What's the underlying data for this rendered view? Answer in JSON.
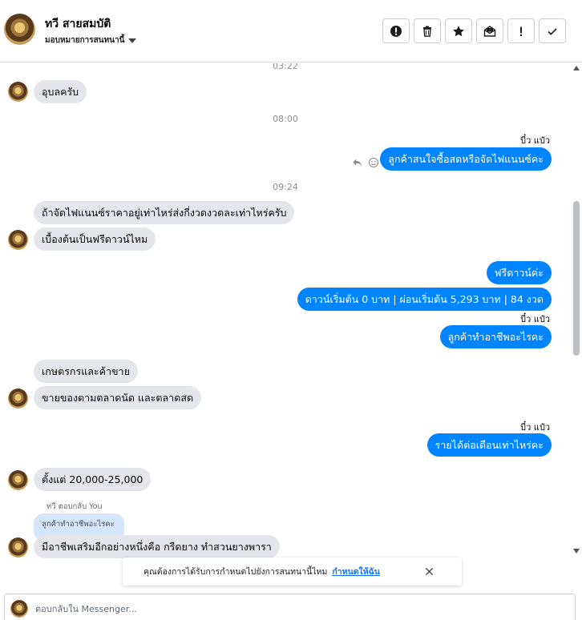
{
  "header": {
    "contact_name": "ทวี สายสมบัติ",
    "assign_label": "มอบหมายการสนทนานี้",
    "tools": [
      {
        "icon": "alert-circle-icon",
        "name": "spam-button"
      },
      {
        "icon": "trash-icon",
        "name": "delete-button"
      },
      {
        "icon": "star-icon",
        "name": "star-button"
      },
      {
        "icon": "mail-open-icon",
        "name": "mark-unread-button"
      },
      {
        "icon": "exclamation-icon",
        "name": "follow-up-button"
      },
      {
        "icon": "check-icon",
        "name": "done-button"
      }
    ]
  },
  "conversation": {
    "timestamps": [
      "03:22",
      "08:00",
      "09:24"
    ],
    "messages": {
      "m1": "อุบลครับ",
      "m2": "ลูกค้าสนใจซื้อสดหรือจัดไฟแนนซ์คะ",
      "m3": "ถ้าจัดไฟแนนซ์ราคาอยู่เท่าไหร่ส่งกี่งวดงวดละเท่าไหร่ครับ",
      "m4": "เบื้องต้นเป็นฟรีดาวน์ไหม",
      "m5": "ฟรีดาวน์ค่ะ",
      "m6": "ดาวน์เริ่มต้น 0 บาท | ผ่อนเริ่มต้น 5,293 บาท | 84 งวด",
      "m7": "ลูกค้าทำอาชีพอะไรคะ",
      "m8": "เกษตรกรและค้าขาย",
      "m9": "ขายของตามตลาดนัด และตลาดสด",
      "m10": "รายได้ต่อเดือนเท่าไหร่คะ",
      "m11": "ตั้งแต่ 20,000-25,000",
      "m12": "มีอาชีพเสริมอีกอย่างหนึ่งคือ กรีดยาง ทำสวนยางพารา"
    },
    "seen_label": "บี๋ว แป๋ว",
    "reply_label": "ทวี ตอบกลับ You",
    "quoted_text": "ลูกค้าทำอาชีพอะไรคะ"
  },
  "toast": {
    "text": "คุณต้องการได้รับการกำหนดไปยังการสนทนานี้ไหม",
    "link": "กำหนดให้ฉัน"
  },
  "composer": {
    "placeholder": "ตอบกลับใน Messenger..."
  }
}
